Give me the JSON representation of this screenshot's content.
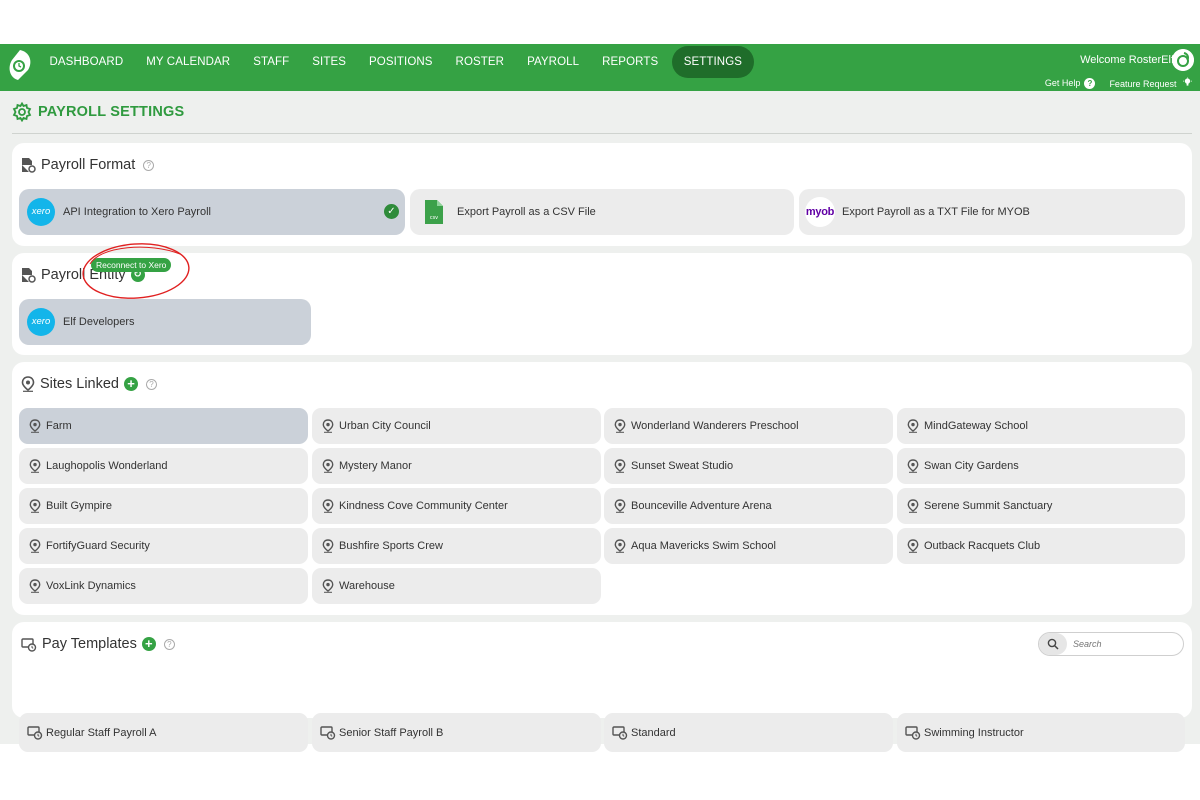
{
  "nav": {
    "items": [
      "DASHBOARD",
      "MY CALENDAR",
      "STAFF",
      "SITES",
      "POSITIONS",
      "ROSTER",
      "PAYROLL",
      "REPORTS",
      "SETTINGS"
    ],
    "active": "SETTINGS",
    "welcome": "Welcome RosterElf",
    "get_help": "Get Help",
    "feature_request": "Feature Request"
  },
  "page": {
    "title": "PAYROLL SETTINGS"
  },
  "payroll_format": {
    "title": "Payroll Format",
    "options": [
      {
        "label": "API Integration to Xero Payroll",
        "logo": "xero",
        "selected": true
      },
      {
        "label": "Export Payroll as a CSV File",
        "logo": "csv",
        "selected": false
      },
      {
        "label": "Export Payroll as a TXT File for MYOB",
        "logo": "myob",
        "selected": false
      }
    ],
    "xero_logo_text": "xero",
    "csv_logo_text": "csv",
    "myob_logo_text": "myob"
  },
  "payroll_entity": {
    "title": "Payroll Entity",
    "reconnect_label": "Reconnect to Xero",
    "entity_name": "Elf Developers"
  },
  "sites_linked": {
    "title": "Sites Linked",
    "sites": [
      "Farm",
      "Urban City Council",
      "Wonderland Wanderers Preschool",
      "MindGateway School",
      "Laughopolis Wonderland",
      "Mystery Manor",
      "Sunset Sweat Studio",
      "Swan City Gardens",
      "Built Gympire",
      "Kindness Cove Community Center",
      "Bounceville Adventure Arena",
      "Serene Summit Sanctuary",
      "FortifyGuard Security",
      "Bushfire Sports Crew",
      "Aqua Mavericks Swim School",
      "Outback Racquets Club",
      "VoxLink Dynamics",
      "Warehouse"
    ],
    "selected": "Farm"
  },
  "pay_templates": {
    "title": "Pay Templates",
    "search_placeholder": "Search",
    "templates": [
      "Regular Staff Payroll A",
      "Senior Staff Payroll B",
      "Standard",
      "Swimming Instructor"
    ]
  },
  "colors": {
    "brand_green": "#35a244",
    "active_nav": "#1f6d2a",
    "xero_blue": "#13b5ea",
    "myob_purple": "#6100a5",
    "annotation_red": "#e02020"
  }
}
